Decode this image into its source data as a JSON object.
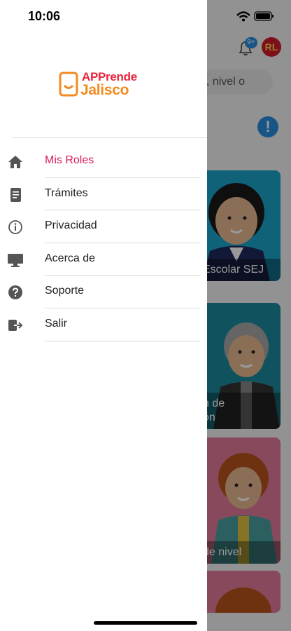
{
  "status_bar": {
    "time": "10:06"
  },
  "app": {
    "notification_badge": "9+",
    "avatar_initials": "RL",
    "search_placeholder_partial": "a, nivel o",
    "info_icon": "!"
  },
  "cards": [
    {
      "label": "Escolar SEJ"
    },
    {
      "label": "n de\nón"
    },
    {
      "label": "de nivel"
    },
    {
      "label": ""
    }
  ],
  "drawer": {
    "logo": {
      "line1": "APPrende",
      "line2": "Jalisco"
    },
    "items": [
      {
        "label": "Mis Roles",
        "icon": "home-icon",
        "active": true
      },
      {
        "label": "Trámites",
        "icon": "document-icon",
        "active": false
      },
      {
        "label": "Privacidad",
        "icon": "info-circle-icon",
        "active": false
      },
      {
        "label": "Acerca de",
        "icon": "monitor-icon",
        "active": false
      },
      {
        "label": "Soporte",
        "icon": "question-circle-icon",
        "active": false
      },
      {
        "label": "Salir",
        "icon": "logout-icon",
        "active": false
      }
    ]
  },
  "colors": {
    "accent": "#d81b60",
    "logo_red": "#e8243c",
    "logo_orange": "#f28b20",
    "badge_blue": "#2a8de0"
  }
}
